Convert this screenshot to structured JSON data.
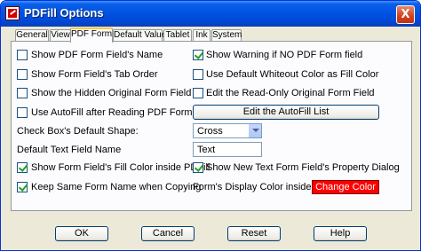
{
  "window": {
    "title": "PDFill Options",
    "close_glyph": "X"
  },
  "tabs": [
    {
      "label": "General"
    },
    {
      "label": "View"
    },
    {
      "label": "PDF Form"
    },
    {
      "label": "Default Value"
    },
    {
      "label": "Tablet"
    },
    {
      "label": "Ink"
    },
    {
      "label": "System"
    }
  ],
  "active_tab": "PDF Form",
  "options": {
    "show_field_name": {
      "label": "Show PDF Form Field's Name",
      "checked": false
    },
    "show_tab_order": {
      "label": "Show Form Field's Tab Order",
      "checked": false
    },
    "show_hidden_original": {
      "label": "Show the Hidden Original Form Field",
      "checked": false
    },
    "use_autofill": {
      "label": "Use AutoFill after Reading PDF Form",
      "checked": false
    },
    "show_warning": {
      "label": "Show Warning if NO PDF Form field",
      "checked": true
    },
    "default_whiteout": {
      "label": "Use Default Whiteout Color as Fill Color",
      "checked": false
    },
    "edit_readonly": {
      "label": "Edit the Read-Only Original Form Field",
      "checked": false
    },
    "show_fill_color": {
      "label": "Show Form Field's Fill Color inside PDFill",
      "checked": true
    },
    "show_property_dialog": {
      "label": "Show New Text Form Field's Property Dialog",
      "checked": true
    },
    "keep_same_name": {
      "label": "Keep Same Form Name when Copying",
      "checked": true
    }
  },
  "edit_autofill_button": "Edit the AutoFill List",
  "checkbox_shape": {
    "label": "Check Box's Default Shape:",
    "value": "Cross"
  },
  "text_field_name": {
    "label": "Default Text Field Name",
    "value": "Text"
  },
  "display_color": {
    "label": "Form's Display Color inside PDFill",
    "button": "Change Color",
    "color": "#ff0000"
  },
  "buttons": {
    "ok": "OK",
    "cancel": "Cancel",
    "reset": "Reset",
    "help": "Help"
  },
  "colors": {
    "titlebar": "#0054e3",
    "dialog_bg": "#ece9d8",
    "active_tab_accent": "#ffc83c"
  }
}
